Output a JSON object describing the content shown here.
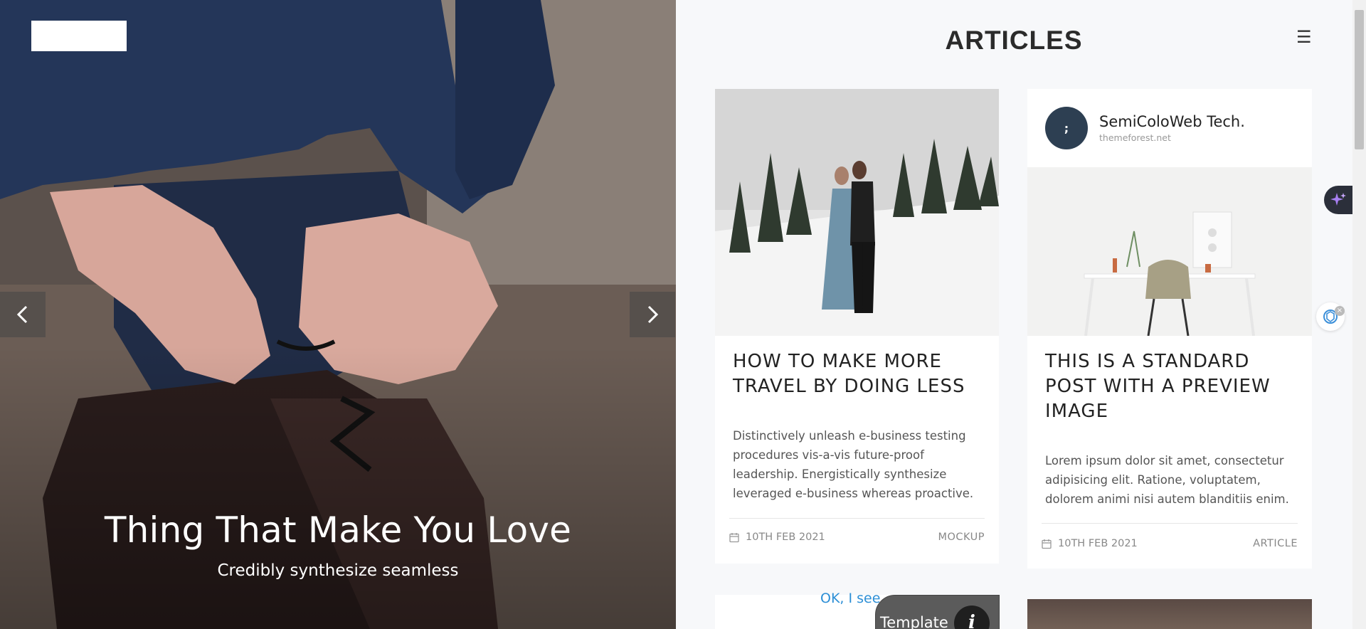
{
  "hero": {
    "title": "Thing That Make You Love",
    "subtitle": "Credibly synthesize seamless",
    "prev_icon": "chevron-left-icon",
    "next_icon": "chevron-right-icon"
  },
  "header": {
    "title": "ARTICLES",
    "menu_glyph": "☰",
    "menu_icon": "hamburger-menu-icon"
  },
  "articles": [
    {
      "title": "HOW TO MAKE MORE TRAVEL BY DOING LESS",
      "text": "Distinctively unleash e-business testing procedures vis-a-vis future-proof leadership. Energistically synthesize leveraged e-business whereas proactive.",
      "date": "10TH FEB 2021",
      "category": "MOCKUP",
      "image": "couple-in-snow-photo"
    },
    {
      "author_name": "SemiColoWeb Tech.",
      "author_site": "themeforest.net",
      "avatar_text": ";",
      "title": "THIS IS A STANDARD POST WITH A PREVIEW IMAGE",
      "text": "Lorem ipsum dolor sit amet, consectetur adipisicing elit. Ratione, voluptatem, dolorem animi nisi autem blanditiis enim.",
      "date": "10TH FEB 2021",
      "category": "ARTICLE",
      "image": "desk-chair-photo"
    }
  ],
  "overlay": {
    "ok_link": "OK, I see",
    "template_label": "Template",
    "info_glyph": "i"
  },
  "colors": {
    "accent_link": "#2d8fd6",
    "avatar_bg": "#2d3f52",
    "page_bg": "#f7f8fa"
  }
}
